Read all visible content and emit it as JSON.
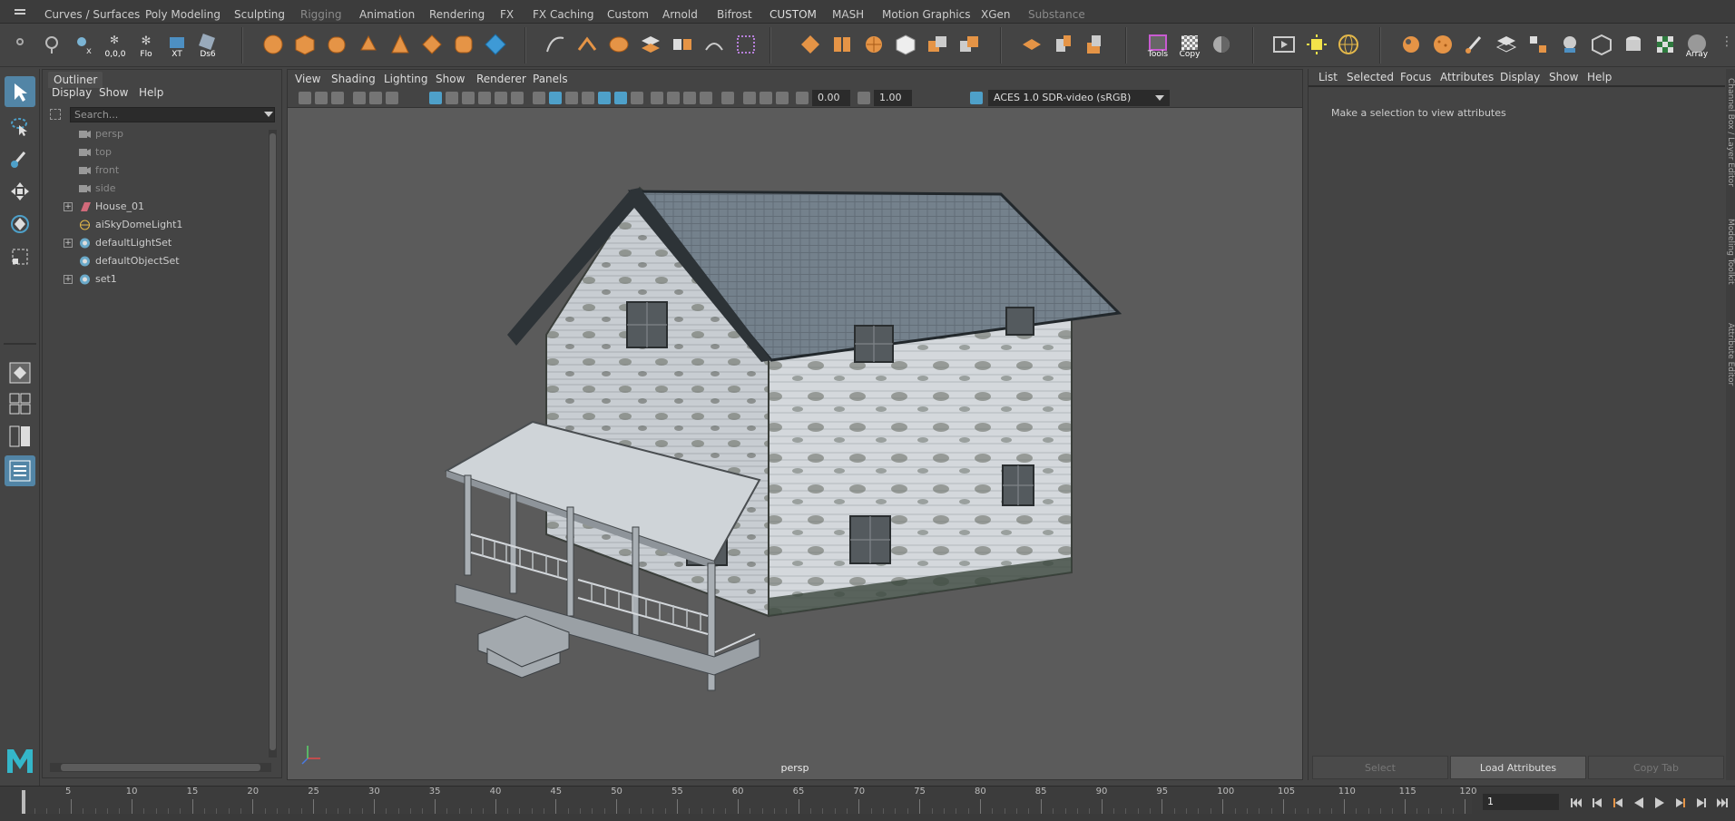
{
  "shelf_tabs": [
    {
      "label": "Curves / Surfaces",
      "state": "normal"
    },
    {
      "label": "Poly Modeling",
      "state": "normal"
    },
    {
      "label": "Sculpting",
      "state": "normal"
    },
    {
      "label": "Rigging",
      "state": "dim"
    },
    {
      "label": "Animation",
      "state": "normal"
    },
    {
      "label": "Rendering",
      "state": "normal"
    },
    {
      "label": "FX",
      "state": "normal"
    },
    {
      "label": "FX Caching",
      "state": "normal"
    },
    {
      "label": "Custom",
      "state": "normal"
    },
    {
      "label": "Arnold",
      "state": "normal"
    },
    {
      "label": "Bifrost",
      "state": "normal"
    },
    {
      "label": "CUSTOM",
      "state": "active"
    },
    {
      "label": "MASH",
      "state": "normal"
    },
    {
      "label": "Motion Graphics",
      "state": "normal"
    },
    {
      "label": "XGen",
      "state": "normal"
    },
    {
      "label": "Substance",
      "state": "dim"
    }
  ],
  "shelf": {
    "coord_label": "0,0,0",
    "flo_label": "Flo",
    "xt_label": "XT",
    "ds_label": "Ds6",
    "tools_label": "Tools",
    "copy_label": "Copy",
    "array_label": "Array"
  },
  "outliner": {
    "title": "Outliner",
    "menu": [
      "Display",
      "Show",
      "Help"
    ],
    "search_placeholder": "Search...",
    "items": [
      {
        "label": "persp",
        "type": "camera",
        "dim": true
      },
      {
        "label": "top",
        "type": "camera",
        "dim": true
      },
      {
        "label": "front",
        "type": "camera",
        "dim": true
      },
      {
        "label": "side",
        "type": "camera",
        "dim": true
      },
      {
        "label": "House_01",
        "type": "mesh",
        "dim": false,
        "expandable": true
      },
      {
        "label": "aiSkyDomeLight1",
        "type": "light",
        "dim": false
      },
      {
        "label": "defaultLightSet",
        "type": "set",
        "dim": false,
        "expandable": true
      },
      {
        "label": "defaultObjectSet",
        "type": "set",
        "dim": false
      },
      {
        "label": "set1",
        "type": "set",
        "dim": false,
        "expandable": true
      }
    ]
  },
  "viewport": {
    "menu": [
      "View",
      "Shading",
      "Lighting",
      "Show",
      "Renderer",
      "Panels"
    ],
    "exposure": "0.00",
    "gamma": "1.00",
    "color_space": "ACES 1.0 SDR-video (sRGB)",
    "camera": "persp"
  },
  "attribute_editor": {
    "menu": [
      "List",
      "Selected",
      "Focus",
      "Attributes",
      "Display",
      "Show",
      "Help"
    ],
    "message": "Make a selection to view attributes",
    "buttons": [
      "Select",
      "Load Attributes",
      "Copy Tab"
    ],
    "side_tabs": [
      "Channel Box / Layer Editor",
      "Modeling Toolkit",
      "Attribute Editor"
    ]
  },
  "timeline": {
    "ticks": [
      "5",
      "10",
      "15",
      "20",
      "25",
      "30",
      "35",
      "40",
      "45",
      "50",
      "55",
      "60",
      "65",
      "70",
      "75",
      "80",
      "85",
      "90",
      "95",
      "100",
      "105",
      "110",
      "115",
      "120"
    ],
    "current_frame": "1"
  },
  "colors": {
    "accent": "#5285a6",
    "orange": "#e0883a"
  }
}
